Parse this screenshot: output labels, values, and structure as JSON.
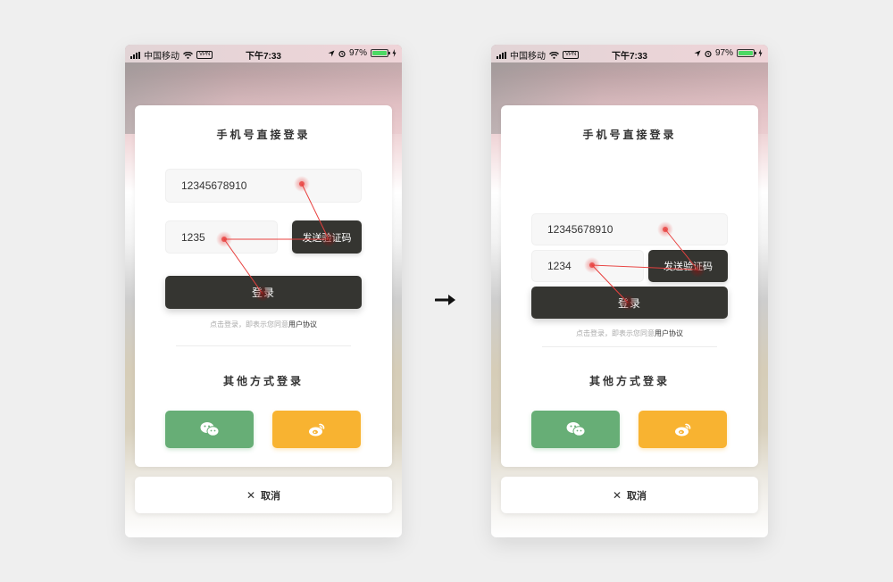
{
  "status_bar": {
    "carrier": "中国移动",
    "vpn": "VPN",
    "time": "下午7:33",
    "battery": "97%",
    "battery_level": 0.97
  },
  "login_card": {
    "title": "手机号直接登录",
    "send_code_label": "发送验证码",
    "login_label": "登录",
    "agreement_prefix": "点击登录，即表示您同意",
    "agreement_link": "用户协议",
    "other_title": "其他方式登录",
    "wechat_icon": "wechat-icon",
    "weibo_icon": "weibo-icon"
  },
  "left_screen": {
    "phone_value": "12345678910",
    "code_value": "1235"
  },
  "right_screen": {
    "phone_value": "12345678910",
    "code_value": "1234"
  },
  "cancel_label": "取消",
  "colors": {
    "dark_button": "#353531",
    "wechat": "#67ae76",
    "weibo": "#f8b331",
    "touch": "#e8413f",
    "battery": "#4cd964"
  }
}
